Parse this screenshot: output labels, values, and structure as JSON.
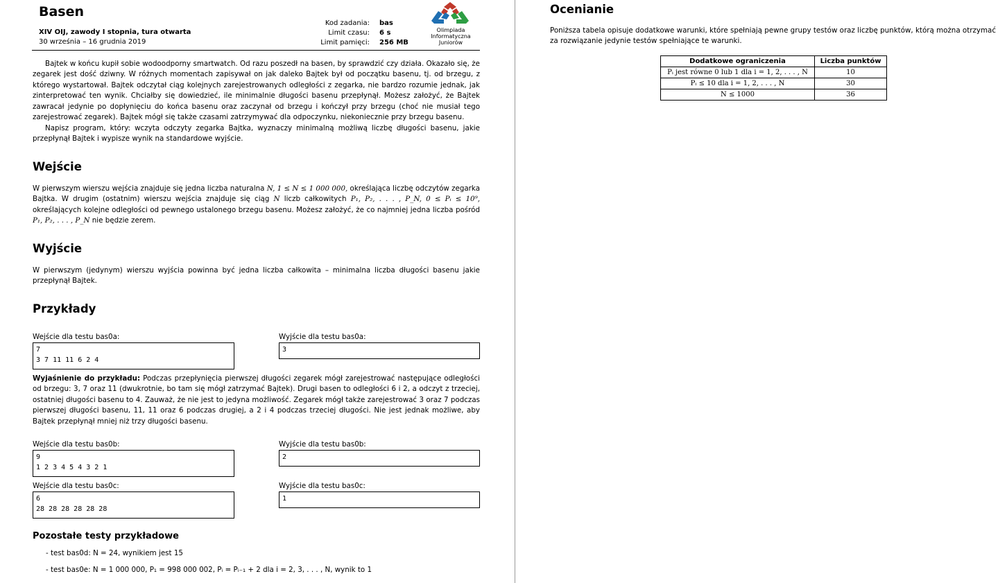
{
  "header": {
    "title": "Basen",
    "contest": "XIV OIJ, zawody I stopnia, tura otwarta",
    "dates": "30 września – 16 grudnia 2019",
    "meta": [
      {
        "label": "Kod zadania:",
        "value": "bas"
      },
      {
        "label": "Limit czasu:",
        "value": "6 s"
      },
      {
        "label": "Limit pamięci:",
        "value": "256 MB"
      }
    ],
    "logo_lines": [
      "Olimpiada",
      "Informatyczna",
      "Juniorów"
    ]
  },
  "statement": {
    "p1": "Bajtek w końcu kupił sobie wodoodporny smartwatch. Od razu poszedł na basen, by sprawdzić czy działa. Okazało się, że zegarek jest dość dziwny. W różnych momentach zapisywał on jak daleko Bajtek był od początku basenu, tj. od brzegu, z którego wystartował. Bajtek odczytał ciąg kolejnych zarejestrowanych odległości z zegarka, nie bardzo rozumie jednak, jak zinterpretować ten wynik. Chciałby się dowiedzieć, ile minimalnie długości basenu przepłynął. Możesz założyć, że Bajtek zawracał jedynie po dopłynięciu do końca basenu oraz zaczynał od brzegu i kończył przy brzegu (choć nie musiał tego zarejestrować zegarek). Bajtek mógł się także czasami zatrzymywać dla odpoczynku, niekoniecznie przy brzegu basenu.",
    "p2": "Napisz program, który: wczyta odczyty zegarka Bajtka, wyznaczy minimalną możliwą liczbę długości basenu, jakie przepłynął Bajtek i wypisze wynik na standardowe wyjście."
  },
  "input_section": {
    "heading": "Wejście",
    "t1": "W pierwszym wierszu wejścia znajduje się jedna liczba naturalna ",
    "m1": "N, 1 ≤ N ≤ 1 000 000,",
    "t2": " określająca liczbę odczytów zegarka Bajtka. W drugim (ostatnim) wierszu wejścia znajduje się ciąg ",
    "m2": "N",
    "t3": " liczb całkowitych ",
    "m3": "P₁, P₂, . . . , P_N, 0 ≤ Pᵢ ≤ 10⁹,",
    "t4": " określających kolejne odległości od pewnego ustalonego brzegu basenu. Możesz założyć, że co najmniej jedna liczba pośród ",
    "m4": "P₁, P₂, . . . , P_N",
    "t5": " nie będzie zerem."
  },
  "output_section": {
    "heading": "Wyjście",
    "text": "W pierwszym (jedynym) wierszu wyjścia powinna być jedna liczba całkowita – minimalna liczba długości basenu jakie przepłynął Bajtek."
  },
  "examples": {
    "heading": "Przykłady",
    "ex_a": {
      "in_label": "Wejście dla testu bas0a:",
      "in": "7\n3 7 11 11 6 2 4",
      "out_label": "Wyjście dla testu bas0a:",
      "out": "3"
    },
    "explain_bold": "Wyjaśnienie do przykładu:",
    "explain": " Podczas przepłynięcia pierwszej długości zegarek mógł zarejestrować następujące odległości od brzegu: 3, 7 oraz 11 (dwukrotnie, bo tam się mógł zatrzymać Bajtek). Drugi basen to odległości 6 i 2, a odczyt z trzeciej, ostatniej długości basenu to 4. Zauważ, że nie jest to jedyna możliwość. Zegarek mógł także zarejestrować 3 oraz 7 podczas pierwszej długości basenu, 11, 11 oraz 6 podczas drugiej, a 2 i 4 podczas trzeciej długości. Nie jest jednak możliwe, aby Bajtek przepłynął mniej niż trzy długości basenu.",
    "ex_b": {
      "in_label": "Wejście dla testu bas0b:",
      "in": "9\n1 2 3 4 5 4 3 2 1",
      "out_label": "Wyjście dla testu bas0b:",
      "out": "2"
    },
    "ex_c": {
      "in_label": "Wejście dla testu bas0c:",
      "in": "6\n28 28 28 28 28 28",
      "out_label": "Wyjście dla testu bas0c:",
      "out": "1"
    }
  },
  "other_tests": {
    "heading": "Pozostałe testy przykładowe",
    "items": [
      "- test bas0d: N = 24, wynikiem jest 15",
      "- test bas0e: N = 1 000 000, P₁ = 998 000 002, Pᵢ = Pᵢ₋₁ + 2 dla i = 2, 3, . . . , N, wynik to 1"
    ]
  },
  "scoring": {
    "heading": "Ocenianie",
    "text": "Poniższa tabela opisuje dodatkowe warunki, które spełniają pewne grupy testów oraz liczbę punktów, którą można otrzymać za rozwiązanie jedynie testów spełniające te warunki.",
    "col_cond": "Dodatkowe ograniczenia",
    "col_pts": "Liczba punktów",
    "rows": [
      {
        "cond": "Pᵢ jest równe 0 lub 1 dla i = 1, 2, . . . , N",
        "pts": "10"
      },
      {
        "cond": "Pᵢ ≤ 10 dla i = 1, 2, . . . , N",
        "pts": "30"
      },
      {
        "cond": "N ≤ 1000",
        "pts": "36"
      }
    ]
  }
}
